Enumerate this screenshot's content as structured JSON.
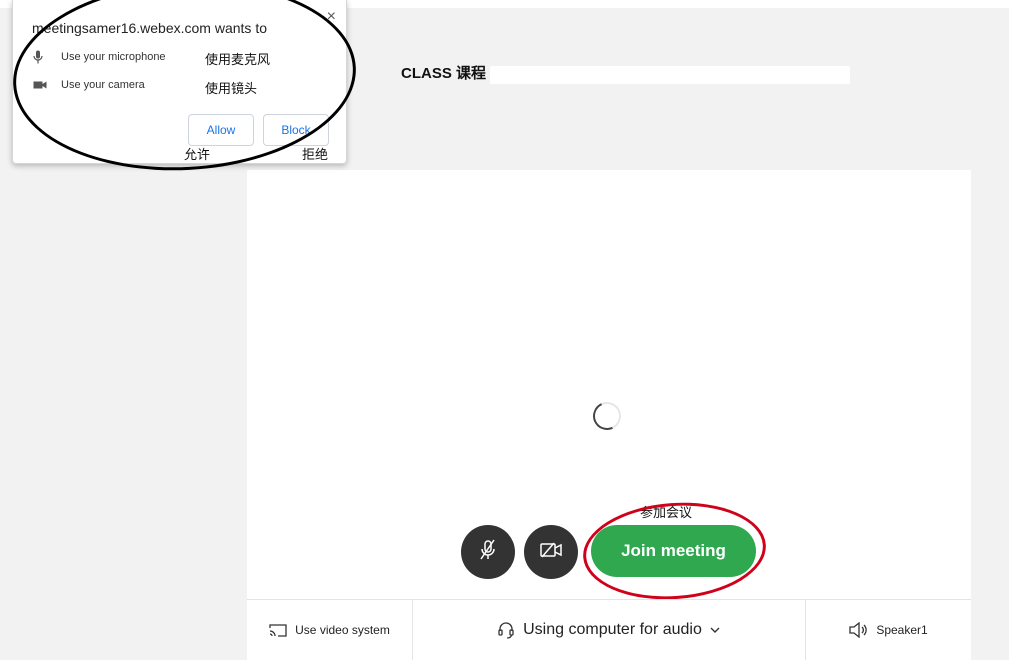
{
  "permission_popup": {
    "title": "meetingsamer16.webex.com wants to",
    "close_glyph": "×",
    "microphone": {
      "label": "Use your microphone",
      "note": "使用麦克风",
      "icon": "microphone-icon"
    },
    "camera": {
      "label": "Use your camera",
      "note": "使用镜头",
      "icon": "camera-icon"
    },
    "allow_label": "Allow",
    "block_label": "Block",
    "allow_note": "允许",
    "block_note": "拒绝"
  },
  "meeting": {
    "title": "CLASS 课程"
  },
  "controls": {
    "join_note": "参加会议",
    "join_label": "Join meeting",
    "mic_icon": "mic-muted-icon",
    "camera_icon": "camera-off-icon"
  },
  "bottom_bar": {
    "video_system_label": "Use video system",
    "audio_label": "Using computer for audio",
    "speaker_label": "Speaker1"
  },
  "colors": {
    "join_green": "#2fa84f",
    "control_dark": "#333333",
    "link_blue": "#1a73e8",
    "annotation_red": "#d0021b",
    "annotation_black": "#000000"
  }
}
